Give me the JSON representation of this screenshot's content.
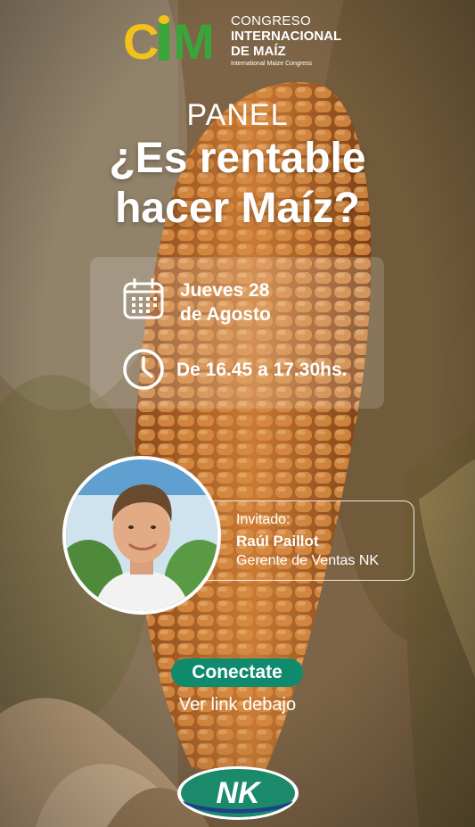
{
  "logo": {
    "mark": "CIM",
    "line1": "CONGRESO",
    "line2": "INTERNACIONAL",
    "line3": "DE MAÍZ",
    "line4": "International Maize Congress"
  },
  "panel_label": "PANEL",
  "title_line1": "¿Es rentable",
  "title_line2": "hacer Maíz?",
  "date": {
    "icon": "calendar-icon",
    "line1": "Jueves 28",
    "line2": "de Agosto"
  },
  "time": {
    "icon": "clock-icon",
    "text": "De 16.45 a 17.30hs."
  },
  "guest": {
    "role": "Invitado:",
    "name": "Raúl Paillot",
    "title": "Gerente de Ventas NK"
  },
  "cta": {
    "button_label": "Conectate",
    "subtext": "Ver link debajo"
  },
  "sponsor": {
    "logo_text": "NK"
  },
  "colors": {
    "accent_green": "#0f8a6c",
    "logo_yellow": "#f2c21b",
    "logo_green": "#3aa53a"
  }
}
